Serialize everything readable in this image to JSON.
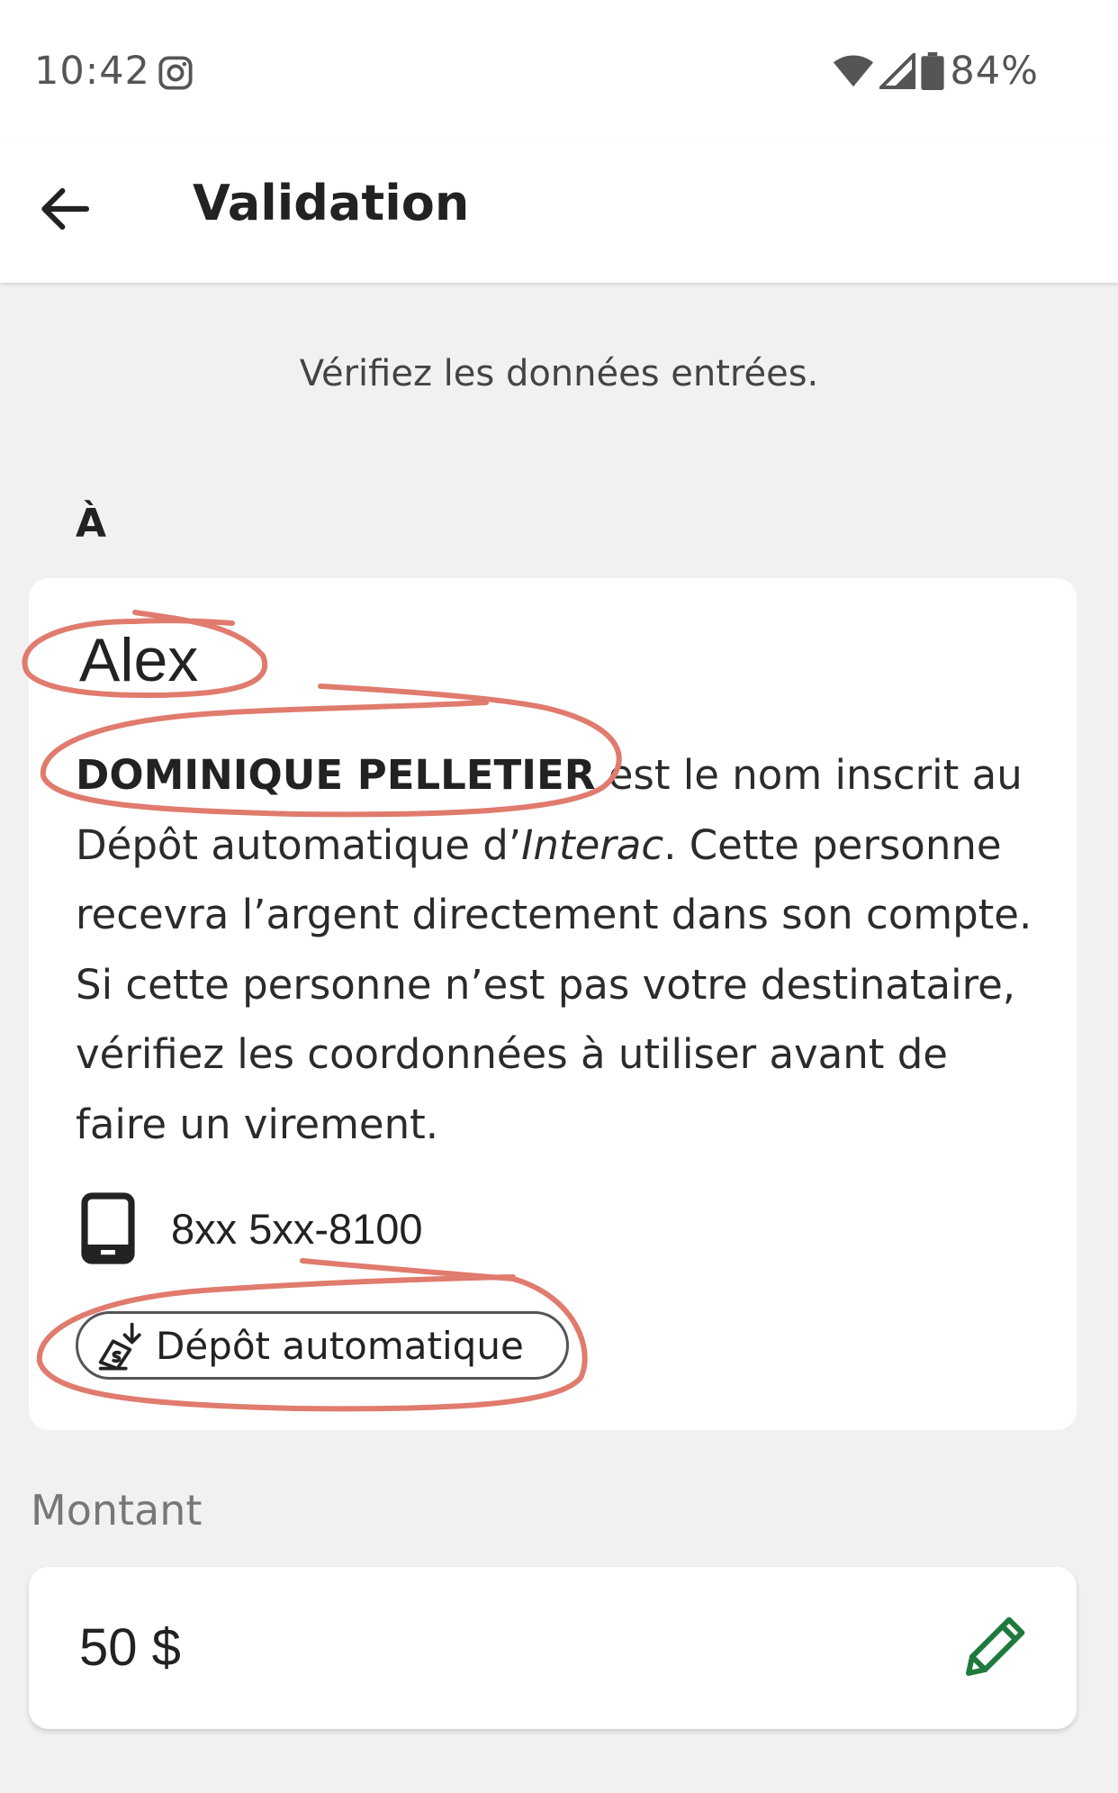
{
  "status_bar": {
    "time": "10:42",
    "battery": "84%",
    "icons": [
      "instagram-icon",
      "wifi-icon",
      "cell-signal-icon",
      "battery-icon"
    ]
  },
  "app_bar": {
    "title": "Validation",
    "back_icon": "arrow-left-icon"
  },
  "subtitle": "Vérifiez les données entrées.",
  "to_label": "À",
  "recipient": {
    "name": "Alex",
    "registered_name": "DOMINIQUE PELLETIER",
    "info_part1": " est le nom inscrit au Dépôt automatique d’",
    "info_brand": "Interac",
    "info_part2": ". Cette personne recevra l’argent directement dans son compte. Si cette personne n’est pas votre destinataire, vérifiez les coordonnées à utiliser avant de faire un virement.",
    "phone": "8xx 5xx-8100",
    "deposit_chip": "Dépôt automatique"
  },
  "amount": {
    "label": "Montant",
    "value": "50 $",
    "edit_icon": "pencil-icon"
  },
  "colors": {
    "accent_green": "#1f7a3d",
    "annotation_red": "#e07b6e",
    "background": "#f1f1f1"
  }
}
